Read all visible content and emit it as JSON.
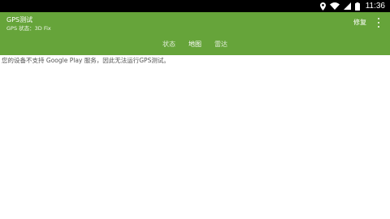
{
  "status_bar": {
    "time": "11:36",
    "icons": [
      "location-icon",
      "wifi-icon",
      "signal-icon",
      "battery-icon"
    ]
  },
  "app_bar": {
    "title": "GPS测试",
    "subtitle": "GPS 状态：3D Fix",
    "repair_label": "修复",
    "color": "#66a43a"
  },
  "tabs": [
    {
      "label": "状态"
    },
    {
      "label": "地图"
    },
    {
      "label": "雷达"
    }
  ],
  "content": {
    "message": "您的设备不支持 Google Play 服务，因此无法运行GPS测试。"
  }
}
